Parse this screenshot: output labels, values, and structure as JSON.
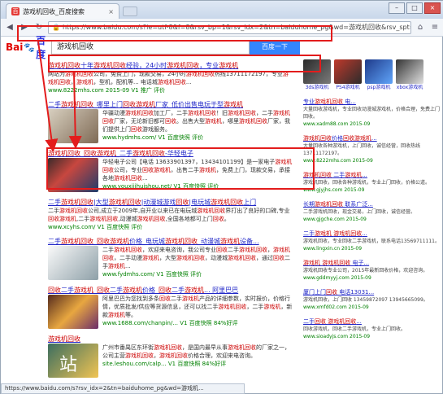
{
  "browser": {
    "tab_title": "游戏机回收_百度搜索",
    "tab_close": "×",
    "url": "https://www.baidu.com/s?ie=utf-8&f=8&rsv_bp=1&rsv_idx=2&tn=baiduhome_pg&wd=游戏机回收&rsv_spt=1&oq=红色电脑&rsv_pq=fa4a284800045c05",
    "back": "◀",
    "forward": "▶",
    "reload": "↻",
    "home": "⌂",
    "menu": "≡",
    "win_min": "–",
    "win_max": "□",
    "win_close": "×",
    "status": "https://www.baidu.com/s?rsv_idx=2&tn=baiduhome_pg&wd=游戏机..."
  },
  "search": {
    "logo_bai": "Bai",
    "logo_paw": "🐾",
    "logo_du": "百度",
    "query": "游戏机回收",
    "button": "百度一下"
  },
  "results": [
    {
      "title": "游戏机回收十年游戏机回收经验，24小时游戏机回收，专业游戏机",
      "abstract": "网站为游戏机回收公司，免费上门，现款交易，24小时游戏机回收热线13711172197，专业游戏机回收，游戏机，型机，配机等... 电话城游戏机回收...",
      "url": "www.8222mhs.com  2015-09  V1  推广  评价"
    },
    {
      "title": "二手游戏机回收_哪里上门回收游戏机厂家_低价出售电玩于型游戏机",
      "abstract": "华疆动漫游戏机回收加工厂，二手游戏机回收！旧游戏机回收，二手游戏机回收厂家，无论新旧都可回收。出售大型游戏机，哪里游戏机回收厂家，我们提供上门回收游戏服务。",
      "url": "www.hydmhs.com/  V1  百度快照  评价"
    },
    {
      "title": "游戏机回收_回收游戏机_二手游戏机回收-华轻电子",
      "abstract": "华轻电子公司【电话 13633901397，13434101199】是一家电子游戏机回收公司，专业回收游戏机，出售二手游戏机，免费上门，现款交易，承接各地游戏机回收...",
      "url": "www.youxijihuishou.net/  V1  百度快照  评价"
    },
    {
      "title": "二手游戏机回收|大型游戏机回收|动漫城游戏回收|电玩城游戏机回收上门",
      "abstract": "二手游戏机回收公司,成立于2009年,自开业以来已在电玩城游戏机回收界打出了良好的口碑,专业回收游戏机,二手游戏机回收,动漫城游戏机回收,全国各地都可上门回收。",
      "url": "www.xcyhs.com/  V1  百度快照  评价"
    },
    {
      "title": "二手游戏机回收_回收游戏机价格_电玩城游戏机回收_动漫城游戏机设备...",
      "abstract": "二手游戏机回收，欢迎来电咨询，我公司专业回收二手游戏机回收，游戏机回收，二手动漫游戏机，大型游戏机回收，动漫城游戏机回收，通过回收二手游戏机...",
      "url": "www.fydmhs.com/  V1  百度快照  评价"
    },
    {
      "title": "回收二手游戏机_回收二手游戏机价格_回收二手游戏机... 阿里巴巴",
      "abstract": "阿里巴巴为您找到多条回收二手游戏机产品的详细参数，实时报价，价格行情，优质批发/供应等货源信息，还可以找二手游戏机回收，二手游戏机，新款游戏机等。",
      "url": "www.1688.com/chanpin/...  V1  百度快照  84%好评"
    },
    {
      "title": "游戏机回收",
      "abstract": "广州市番禺区东环街游戏机回收，是国内最早从事游戏机回收的厂家之一，公司主营游戏机回收，游戏机回收价格合理，欢迎来电咨询。",
      "url": "site.leshou.com/calp...  V1  百度快照  84%好评"
    }
  ],
  "sidebar": {
    "images": [
      {
        "cap": "3ds游戏机"
      },
      {
        "cap": "PS4游戏机"
      },
      {
        "cap": "psp游戏机"
      },
      {
        "cap": "xbox游戏机"
      }
    ],
    "ads": [
      {
        "title": "专业游戏机回收 电...",
        "body": "大量回收游戏机，专业回收动漫城游戏机，价格合理，免费上门回收。",
        "url": "www.xadm88.com 2015-09"
      },
      {
        "title": "游戏机回收价格回收游戏机...",
        "body": "大量回收各种游戏机，上门回收，诚信经营，回收热线13711172197。",
        "url": "www.8222mhs.com 2015-09"
      },
      {
        "title": "游戏机回收 二手游戏机...",
        "body": "游戏机回收，回收各种游戏机，专业上门回收，价格公道。",
        "url": "www.gjyjhs.com 2015-09"
      },
      {
        "title": "长期游戏机回收 联系广泛...",
        "body": "二手游戏机回收，现金交易，上门回收，诚信经营。",
        "url": "www.gjgche.com 2015-09"
      },
      {
        "title": "二手游戏机 游戏机回收...",
        "body": "游戏机回收，专业回收二手游戏机，联系电话13569711111。",
        "url": "www.lingxin.cn 2015-09"
      },
      {
        "title": "游戏机 游戏机回收 电子...",
        "body": "游戏机回收专业公司，2015年最新回收价格，欢迎咨询。",
        "url": "www.gddmyyj.com 2015-09"
      },
      {
        "title": "厦门上门回收 电话13031...",
        "body": "游戏机回收，上门回收 13459872097 13945665099。",
        "url": "www.xmfd02.com 2015-09"
      },
      {
        "title": "二手回收 游戏机回收...",
        "body": "回收游戏机，回收二手游戏机，专业上门回收。",
        "url": "www.sioadyjs.com 2015-09"
      }
    ]
  },
  "colors": {
    "link": "#2127c8",
    "highlight": "#cc0000",
    "url_green": "#008000",
    "annotation_red": "#e31c1c",
    "search_button": "#3385ff"
  }
}
